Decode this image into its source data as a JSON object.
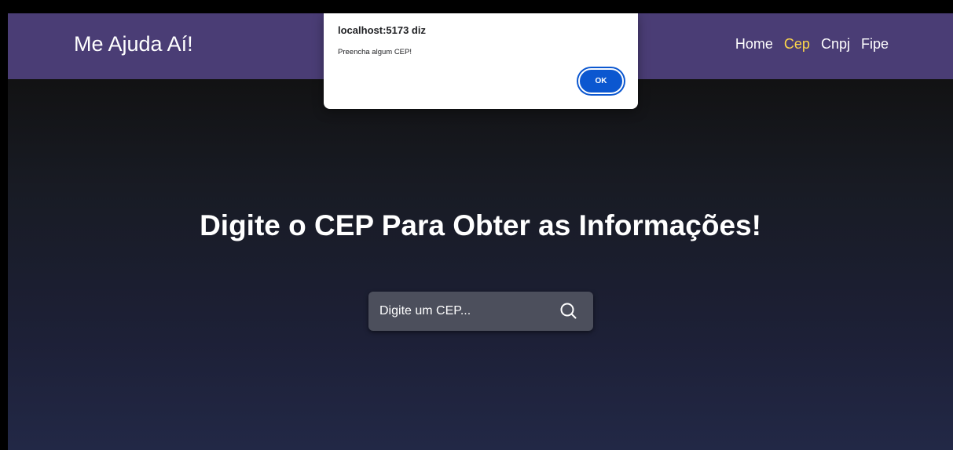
{
  "navbar": {
    "brand": "Me Ajuda Aí!",
    "links": [
      {
        "label": "Home",
        "active": false
      },
      {
        "label": "Cep",
        "active": true
      },
      {
        "label": "Cnpj",
        "active": false
      },
      {
        "label": "Fipe",
        "active": false
      }
    ],
    "colors": {
      "background": "#4a3d75",
      "link": "#ffffff",
      "active_link": "#ffd84a"
    }
  },
  "main": {
    "headline": "Digite o CEP Para Obter as Informações!",
    "search": {
      "placeholder": "Digite um CEP...",
      "value": "",
      "icon": "search-icon"
    }
  },
  "alert_dialog": {
    "title": "localhost:5173 diz",
    "message": "Preencha algum CEP!",
    "ok_label": "OK",
    "accent_color": "#0b57d0"
  }
}
